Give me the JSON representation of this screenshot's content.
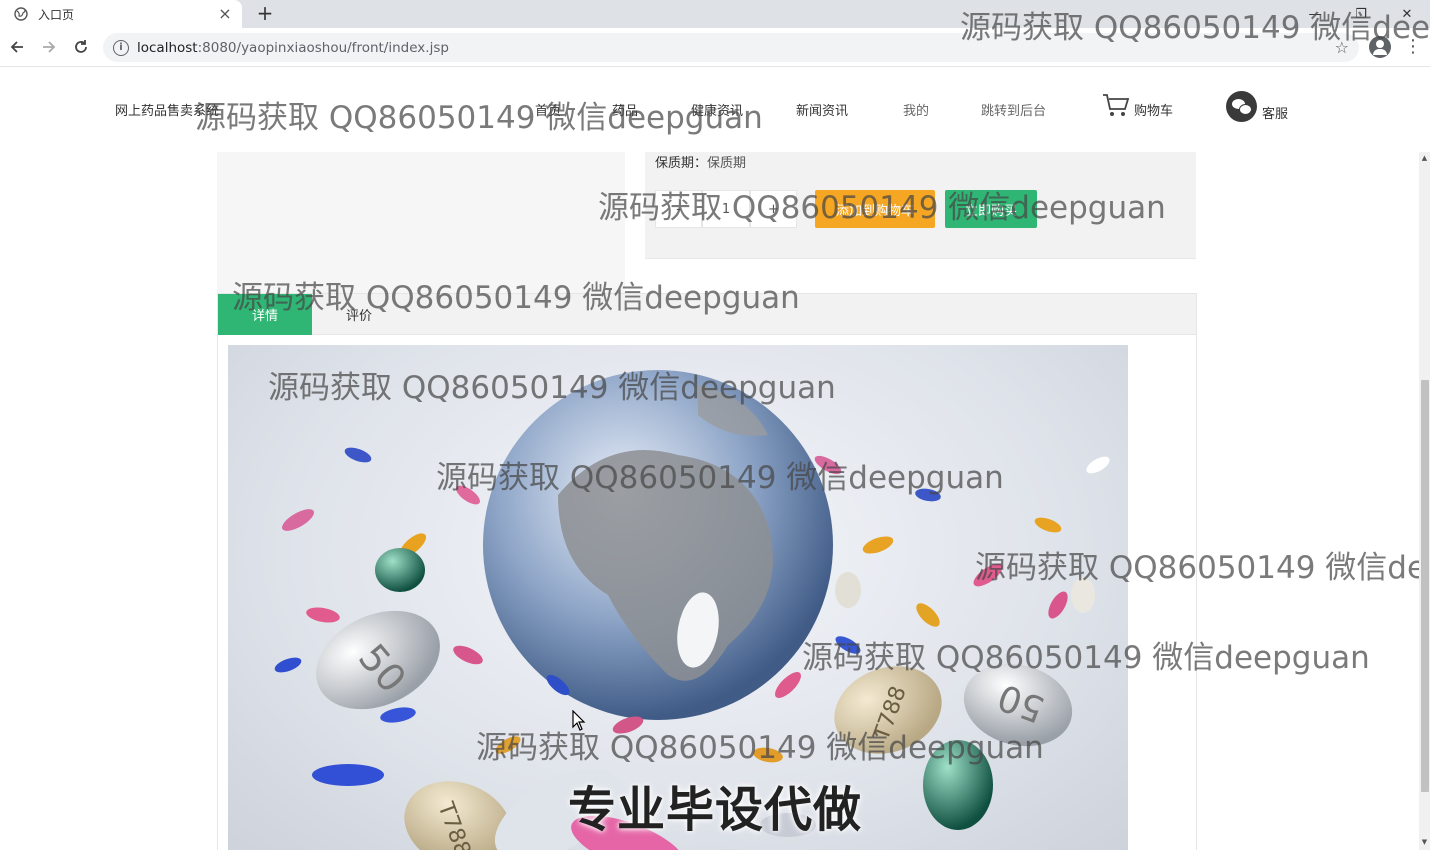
{
  "browser": {
    "tab_title": "入口页",
    "tab_close": "×",
    "new_tab": "+",
    "window_controls": [
      "—",
      "❐",
      "✕"
    ],
    "url_host": "localhost",
    "url_path": ":8080/yaopinxiaoshou/front/index.jsp"
  },
  "header": {
    "site_name": "网上药品售卖系统",
    "nav": [
      {
        "label": "首页"
      },
      {
        "label": "药品"
      },
      {
        "label": "健康资讯"
      },
      {
        "label": "新闻资讯"
      },
      {
        "label": "我的"
      },
      {
        "label": "跳转到后台"
      }
    ],
    "cart_label": "购物车",
    "service_label": "客服"
  },
  "product": {
    "shelf_life_label": "保质期：",
    "shelf_life_value": "保质期",
    "qty_minus": "-",
    "qty_value": "1",
    "qty_plus": "+",
    "add_to_cart": "添加到购物车",
    "buy_now": "立即购买"
  },
  "tabs": {
    "detail": "详情",
    "review": "评价"
  },
  "detail_image": {
    "caption": "专业毕设代做",
    "pill_labels": [
      "50",
      "50",
      "T788",
      "T788"
    ]
  },
  "watermark": "源码获取 QQ86050149 微信deepguan",
  "colors": {
    "accent_green": "#2fb574",
    "cart_orange": "#f5a623"
  }
}
